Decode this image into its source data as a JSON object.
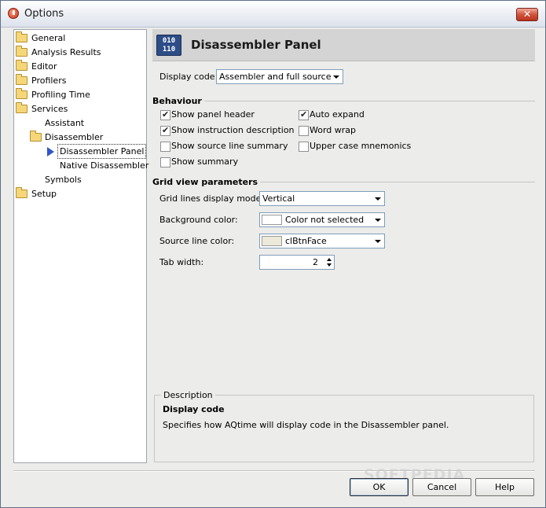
{
  "window": {
    "title": "Options",
    "close_glyph": "✕"
  },
  "tree": {
    "items": [
      {
        "label": "General",
        "icon": "folder-icon"
      },
      {
        "label": "Analysis Results",
        "icon": "folder-icon"
      },
      {
        "label": "Editor",
        "icon": "folder-icon"
      },
      {
        "label": "Profilers",
        "icon": "folder-icon"
      },
      {
        "label": "Profiling Time",
        "icon": "folder-icon"
      },
      {
        "label": "Services",
        "icon": "folder-icon"
      },
      {
        "label": "Assistant"
      },
      {
        "label": "Disassembler",
        "icon": "folder-icon"
      },
      {
        "label": "Disassembler Panel",
        "icon": "arrow-icon",
        "selected": true
      },
      {
        "label": "Native Disassembler"
      },
      {
        "label": "Symbols"
      },
      {
        "label": "Setup",
        "icon": "folder-icon"
      }
    ]
  },
  "panel": {
    "title": "Disassembler Panel",
    "icon_text": "010\n110",
    "display_code": {
      "label": "Display code:",
      "value": "Assembler and full source"
    },
    "behaviour": {
      "title": "Behaviour",
      "options": [
        {
          "label": "Show panel header",
          "checked": true
        },
        {
          "label": "Show instruction description",
          "checked": true
        },
        {
          "label": "Show source line summary",
          "checked": false
        },
        {
          "label": "Show summary",
          "checked": false
        },
        {
          "label": "Auto expand",
          "checked": true
        },
        {
          "label": "Word wrap",
          "checked": false
        },
        {
          "label": "Upper case mnemonics",
          "checked": false
        }
      ]
    },
    "grid": {
      "title": "Grid view parameters",
      "grid_lines": {
        "label": "Grid lines display mode:",
        "value": "Vertical"
      },
      "background": {
        "label": "Background color:",
        "value": "Color not selected",
        "swatch": "#ffffff"
      },
      "source_line": {
        "label": "Source line color:",
        "value": "clBtnFace",
        "swatch": "#ece9d8"
      },
      "tab_width": {
        "label": "Tab width:",
        "value": "2"
      }
    },
    "description": {
      "legend": "Description",
      "title": "Display code",
      "text": "Specifies how AQtime will display code in the Disassembler panel."
    }
  },
  "buttons": {
    "ok": "OK",
    "cancel": "Cancel",
    "help": "Help"
  },
  "watermark": "SOFTPEDIA"
}
